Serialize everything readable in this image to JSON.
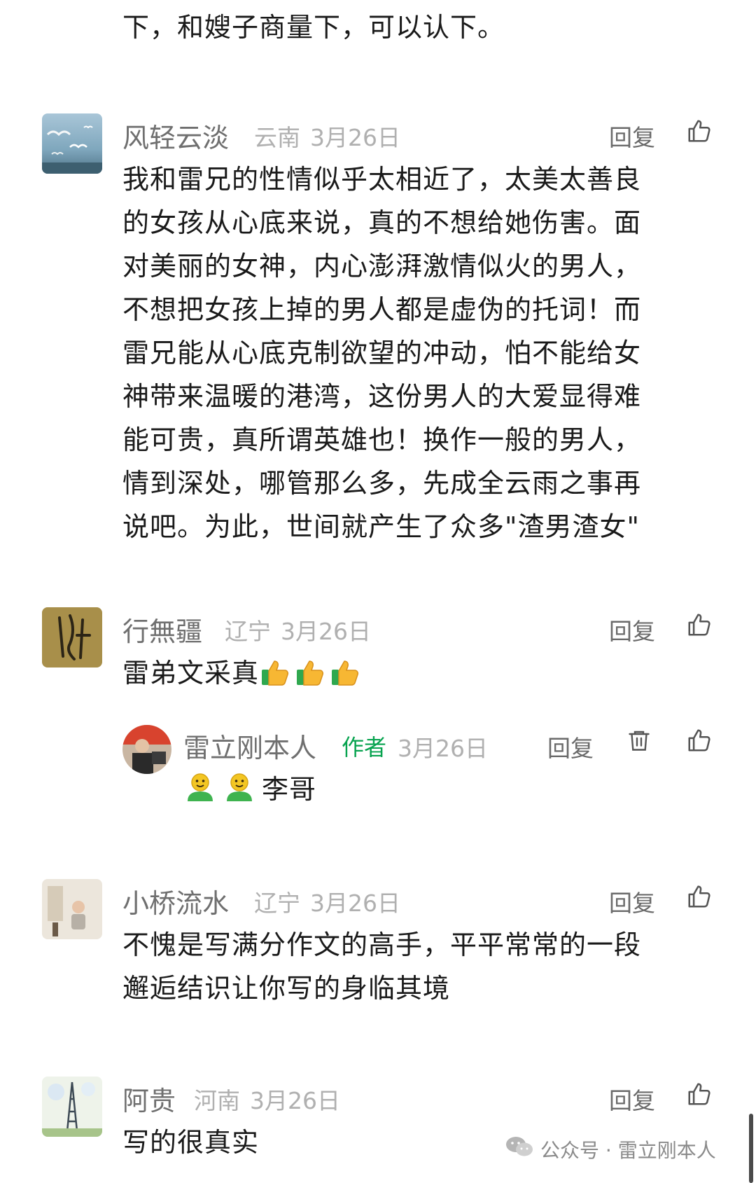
{
  "prev_comment_tail": "下，和嫂子商量下，可以认下。",
  "comments": [
    {
      "name": "风轻云淡",
      "location": "云南",
      "date": "3月26日",
      "reply_label": "回复",
      "lines": [
        "我和雷兄的性情似乎太相近了，太美太善良",
        "的女孩从心底来说，真的不想给她伤害。面",
        "对美丽的女神，内心澎湃激情似火的男人，",
        "不想把女孩上掉的男人都是虚伪的托词！而",
        "雷兄能从心底克制欲望的冲动，怕不能给女",
        "神带来温暖的港湾，这份男人的大爱显得难",
        "能可贵，真所谓英雄也！换作一般的男人，",
        "情到深处，哪管那么多，先成全云雨之事再",
        "说吧。为此，世间就产生了众多\"渣男渣女\""
      ]
    },
    {
      "name": "行無疆",
      "location": "辽宁",
      "date": "3月26日",
      "reply_label": "回复",
      "text": "雷弟文采真",
      "emoji": "thumbs-up",
      "emoji_count": 3,
      "author_reply": {
        "name": "雷立刚本人",
        "badge": "作者",
        "date": "3月26日",
        "reply_label": "回复",
        "emoji": "smiley-figure",
        "emoji_count": 2,
        "text": "李哥"
      }
    },
    {
      "name": "小桥流水",
      "location": "辽宁",
      "date": "3月26日",
      "reply_label": "回复",
      "lines": [
        "不愧是写满分作文的高手，平平常常的一段",
        "邂逅结识让你写的身临其境"
      ]
    },
    {
      "name": "阿贵",
      "location": "河南",
      "date": "3月26日",
      "reply_label": "回复",
      "lines": [
        "写的很真实"
      ]
    }
  ],
  "watermark": "公众号 · 雷立刚本人",
  "icons": {
    "like": "thumbs-up-outline-icon",
    "delete": "trash-icon",
    "wechat": "wechat-logo-icon"
  },
  "colors": {
    "author_badge": "#07a34f",
    "meta": "#b0b0b0",
    "name": "#6f6f6f"
  }
}
